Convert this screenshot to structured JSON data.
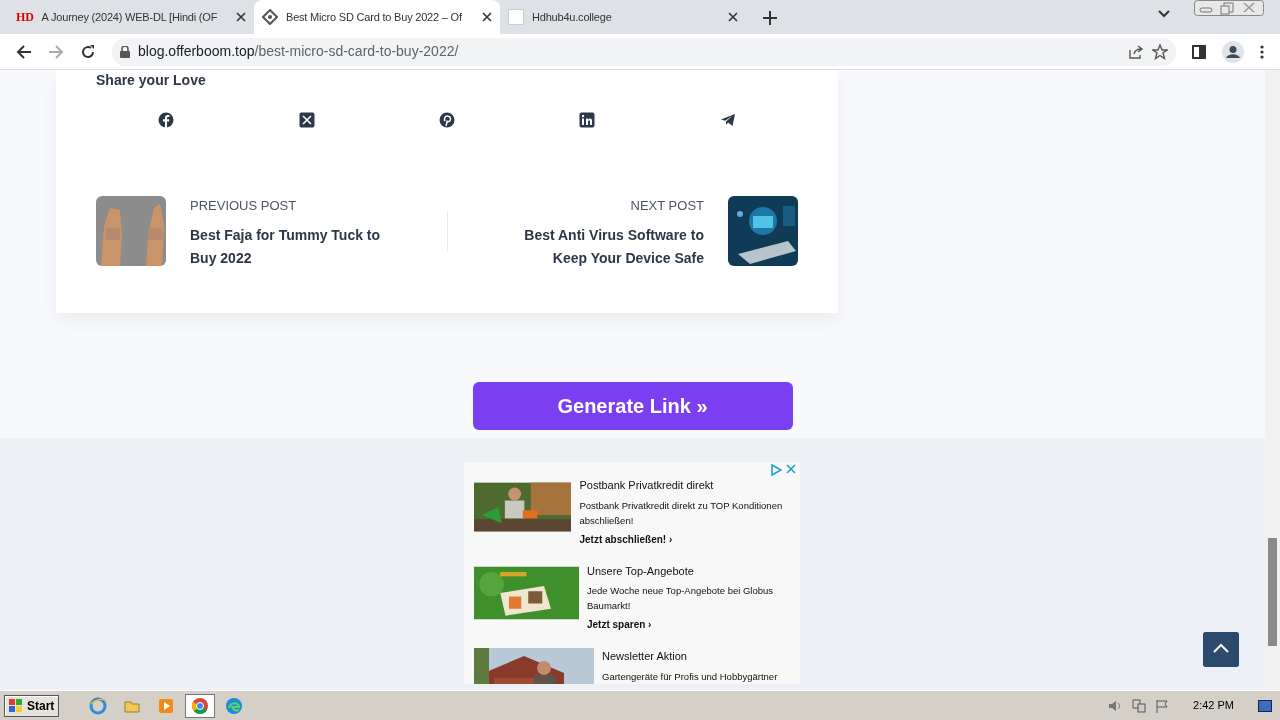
{
  "browser": {
    "tabs": [
      {
        "kind": "hd",
        "favicon_text": "HD",
        "title": "A Journey (2024) WEB-DL [Hindi (OF",
        "selected": false
      },
      {
        "kind": "diamond",
        "title": "Best Micro SD Card to Buy 2022 – Of",
        "selected": true
      },
      {
        "kind": "blank",
        "title": "Hdhub4u.college",
        "selected": false
      }
    ],
    "url_domain": "blog.offerboom.top",
    "url_path": "/best-micro-sd-card-to-buy-2022/"
  },
  "share": {
    "heading": "Share your Love",
    "networks": [
      {
        "kind": "facebook"
      },
      {
        "kind": "x"
      },
      {
        "kind": "pinterest"
      },
      {
        "kind": "linkedin"
      },
      {
        "kind": "telegram"
      }
    ]
  },
  "post_nav": [
    {
      "kind": "previous",
      "label": "PREVIOUS POST",
      "title": "Best Faja for Tummy Tuck to Buy 2022"
    },
    {
      "kind": "next",
      "label": "NEXT POST",
      "title": "Best Anti Virus Software to Keep Your Device Safe"
    }
  ],
  "generate_button": "Generate Link »",
  "ads": [
    {
      "title": "Postbank Privatkredit direkt",
      "text": "Postbank Privatkredit direkt zu TOP Konditionen abschließen!",
      "cta": "Jetzt abschließen! ›"
    },
    {
      "title": "Unsere Top-Angebote",
      "text": "Jede Woche neue Top-Angebote bei Globus Baumarkt!",
      "cta": "Jetzt sparen ›"
    },
    {
      "title": "Newsletter Aktion",
      "text": "Gartengeräte für Profis und Hobbygärtner"
    }
  ],
  "taskbar": {
    "start": "Start",
    "apps": [
      {
        "kind": "ie",
        "selected": false
      },
      {
        "kind": "folder",
        "selected": false
      },
      {
        "kind": "media",
        "selected": false
      },
      {
        "kind": "chrome",
        "selected": true
      },
      {
        "kind": "edge",
        "selected": false
      }
    ],
    "clock": "2:42 PM"
  }
}
